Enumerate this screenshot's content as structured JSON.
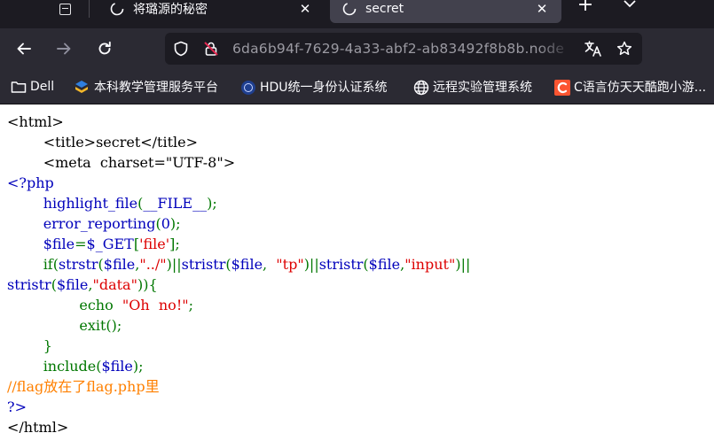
{
  "tabs": [
    {
      "title": "将璐源的秘密",
      "close_label": "✕"
    },
    {
      "title": "secret",
      "close_label": "✕"
    }
  ],
  "new_tab_label": "+",
  "urlbar": {
    "url": "6da6b94f-7629-4a33-abf2-ab83492f8b8b.node"
  },
  "bookmarks": [
    {
      "label": "Dell"
    },
    {
      "label": "本科教学管理服务平台"
    },
    {
      "label": "HDU统一身份认证系统"
    },
    {
      "label": "远程实验管理系统"
    },
    {
      "label": "C语言仿天天酷跑小游..."
    }
  ],
  "colors": {
    "php_default": "#0000bb",
    "php_keyword": "#007700",
    "php_string": "#dd0000",
    "php_comment": "#ff8000",
    "html": "#000000"
  },
  "source_lines": [
    [
      {
        "t": "<html>",
        "c": "html"
      }
    ],
    [
      {
        "t": "        <title>secret</title>",
        "c": "html"
      }
    ],
    [
      {
        "t": "        <meta  charset=\"UTF-8\">",
        "c": "html"
      }
    ],
    [
      {
        "t": "<?php",
        "c": "def"
      }
    ],
    [
      {
        "t": "        highlight_file",
        "c": "def"
      },
      {
        "t": "(",
        "c": "kw"
      },
      {
        "t": "__FILE__",
        "c": "def"
      },
      {
        "t": ");",
        "c": "kw"
      }
    ],
    [
      {
        "t": "        error_reporting",
        "c": "def"
      },
      {
        "t": "(",
        "c": "kw"
      },
      {
        "t": "0",
        "c": "def"
      },
      {
        "t": ");",
        "c": "kw"
      }
    ],
    [
      {
        "t": "        $file",
        "c": "def"
      },
      {
        "t": "=",
        "c": "kw"
      },
      {
        "t": "$_GET",
        "c": "def"
      },
      {
        "t": "[",
        "c": "kw"
      },
      {
        "t": "'file'",
        "c": "str"
      },
      {
        "t": "];",
        "c": "kw"
      }
    ],
    [
      {
        "t": "        if(",
        "c": "kw"
      },
      {
        "t": "strstr",
        "c": "def"
      },
      {
        "t": "(",
        "c": "kw"
      },
      {
        "t": "$file",
        "c": "def"
      },
      {
        "t": ",",
        "c": "kw"
      },
      {
        "t": "\"../\"",
        "c": "str"
      },
      {
        "t": ")||",
        "c": "kw"
      },
      {
        "t": "stristr",
        "c": "def"
      },
      {
        "t": "(",
        "c": "kw"
      },
      {
        "t": "$file",
        "c": "def"
      },
      {
        "t": ",  ",
        "c": "kw"
      },
      {
        "t": "\"tp\"",
        "c": "str"
      },
      {
        "t": ")||",
        "c": "kw"
      },
      {
        "t": "stristr",
        "c": "def"
      },
      {
        "t": "(",
        "c": "kw"
      },
      {
        "t": "$file",
        "c": "def"
      },
      {
        "t": ",",
        "c": "kw"
      },
      {
        "t": "\"input\"",
        "c": "str"
      },
      {
        "t": ")||",
        "c": "kw"
      }
    ],
    [
      {
        "t": "stristr",
        "c": "def"
      },
      {
        "t": "(",
        "c": "kw"
      },
      {
        "t": "$file",
        "c": "def"
      },
      {
        "t": ",",
        "c": "kw"
      },
      {
        "t": "\"data\"",
        "c": "str"
      },
      {
        "t": ")){",
        "c": "kw"
      }
    ],
    [
      {
        "t": "                echo  ",
        "c": "kw"
      },
      {
        "t": "\"Oh  no!\"",
        "c": "str"
      },
      {
        "t": ";",
        "c": "kw"
      }
    ],
    [
      {
        "t": "                exit",
        "c": "kw"
      },
      {
        "t": "();",
        "c": "kw"
      }
    ],
    [
      {
        "t": "        }",
        "c": "kw"
      }
    ],
    [
      {
        "t": "        include(",
        "c": "kw"
      },
      {
        "t": "$file",
        "c": "def"
      },
      {
        "t": ");",
        "c": "kw"
      }
    ],
    [
      {
        "t": "//flag放在了flag.php里",
        "c": "cmt"
      }
    ],
    [
      {
        "t": "?>",
        "c": "def"
      }
    ],
    [
      {
        "t": "</html>",
        "c": "html"
      }
    ]
  ]
}
